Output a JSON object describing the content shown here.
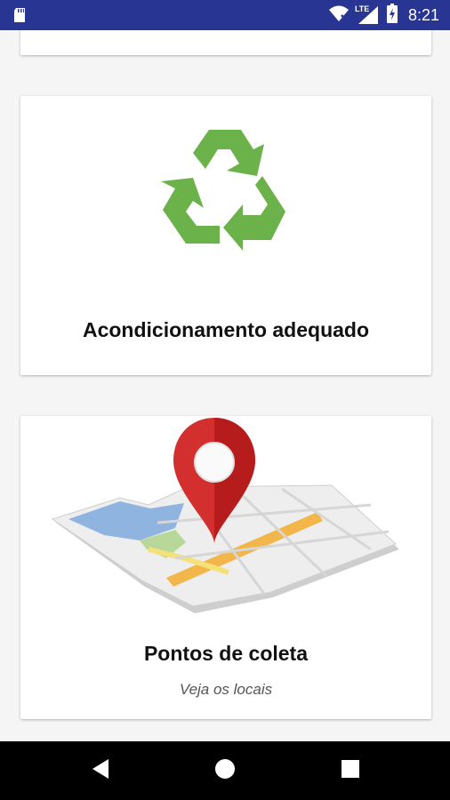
{
  "status_bar": {
    "time": "8:21",
    "network_label": "LTE",
    "icons": [
      "sd-card-icon",
      "wifi-icon",
      "signal-icon",
      "battery-icon"
    ]
  },
  "cards": [
    {
      "title": "Acondicionamento adequado",
      "icon": "recycle-icon",
      "icon_color": "#6cb24a"
    },
    {
      "title": "Pontos de coleta",
      "subtitle": "Veja os locais",
      "icon": "map-pin-icon",
      "pin_color": "#d32f2f"
    }
  ],
  "navigation": {
    "buttons": [
      "back-icon",
      "home-icon",
      "recents-icon"
    ]
  },
  "colors": {
    "status_bar": "#283593",
    "background": "#f5f5f5",
    "card": "#ffffff",
    "nav_bar": "#000000"
  }
}
